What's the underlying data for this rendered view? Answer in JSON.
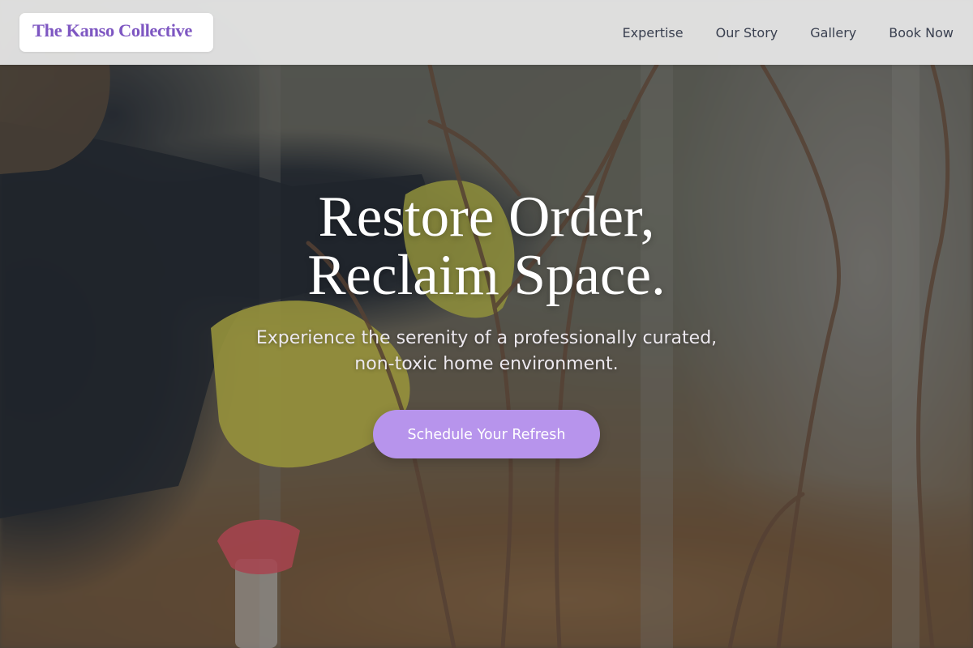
{
  "brand": {
    "name": "The Kanso Collective",
    "color": "#7e57c2"
  },
  "nav": {
    "items": [
      {
        "label": "Expertise"
      },
      {
        "label": "Our Story"
      },
      {
        "label": "Gallery"
      },
      {
        "label": "Book Now"
      }
    ]
  },
  "hero": {
    "headline_line1": "Restore Order,",
    "headline_line2": "Reclaim Space.",
    "subtitle_line1": "Experience the serenity of a professionally curated,",
    "subtitle_line2": "non-toxic home environment.",
    "cta_label": "Schedule Your Refresh",
    "cta_color": "#b794ec",
    "background_image": "gardener-pruning-branches-photo"
  }
}
